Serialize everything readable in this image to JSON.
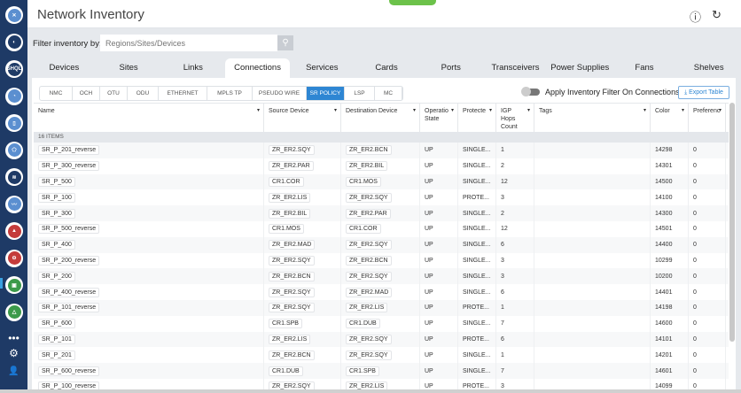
{
  "header": {
    "title": "Network Inventory",
    "help_icon": "help-icon",
    "refresh_icon": "refresh-icon"
  },
  "filter": {
    "label": "Filter inventory by:",
    "placeholder": "Regions/Sites/Devices"
  },
  "tabs": [
    "Devices",
    "Sites",
    "Links",
    "Connections",
    "Services",
    "Cards",
    "Ports",
    "Transceivers",
    "Power Supplies",
    "Fans",
    "Shelves"
  ],
  "active_tab": "Connections",
  "subtabs": [
    "NMC",
    "OCH",
    "OTU",
    "ODU",
    "ETHERNET",
    "MPLS TP",
    "PSEUDO WIRE",
    "SR POLICY",
    "LSP",
    "MC"
  ],
  "active_subtab": "SR POLICY",
  "toggle_label": "Apply Inventory Filter On Connections",
  "export_label": "Export Table",
  "columns": [
    "Name",
    "Source Device",
    "Destination Device",
    "Operatio State",
    "Protecte",
    "IGP Hops Count",
    "Tags",
    "Color",
    "Preferenc"
  ],
  "items_count": "16 ITEMS",
  "rows": [
    [
      "SR_P_201_reverse",
      "ZR_ER2.SQY",
      "ZR_ER2.BCN",
      "UP",
      "SINGLE...",
      "1",
      "",
      "14298",
      "0"
    ],
    [
      "SR_P_300_reverse",
      "ZR_ER2.PAR",
      "ZR_ER2.BIL",
      "UP",
      "SINGLE...",
      "2",
      "",
      "14301",
      "0"
    ],
    [
      "SR_P_500",
      "CR1.COR",
      "CR1.MOS",
      "UP",
      "SINGLE...",
      "12",
      "",
      "14500",
      "0"
    ],
    [
      "SR_P_100",
      "ZR_ER2.LIS",
      "ZR_ER2.SQY",
      "UP",
      "PROTE...",
      "3",
      "",
      "14100",
      "0"
    ],
    [
      "SR_P_300",
      "ZR_ER2.BIL",
      "ZR_ER2.PAR",
      "UP",
      "SINGLE...",
      "2",
      "",
      "14300",
      "0"
    ],
    [
      "SR_P_500_reverse",
      "CR1.MOS",
      "CR1.COR",
      "UP",
      "SINGLE...",
      "12",
      "",
      "14501",
      "0"
    ],
    [
      "SR_P_400",
      "ZR_ER2.MAD",
      "ZR_ER2.SQY",
      "UP",
      "SINGLE...",
      "6",
      "",
      "14400",
      "0"
    ],
    [
      "SR_P_200_reverse",
      "ZR_ER2.SQY",
      "ZR_ER2.BCN",
      "UP",
      "SINGLE...",
      "3",
      "",
      "10299",
      "0"
    ],
    [
      "SR_P_200",
      "ZR_ER2.BCN",
      "ZR_ER2.SQY",
      "UP",
      "SINGLE...",
      "3",
      "",
      "10200",
      "0"
    ],
    [
      "SR_P_400_reverse",
      "ZR_ER2.SQY",
      "ZR_ER2.MAD",
      "UP",
      "SINGLE...",
      "6",
      "",
      "14401",
      "0"
    ],
    [
      "SR_P_101_reverse",
      "ZR_ER2.SQY",
      "ZR_ER2.LIS",
      "UP",
      "PROTE...",
      "1",
      "",
      "14198",
      "0"
    ],
    [
      "SR_P_600",
      "CR1.SPB",
      "CR1.DUB",
      "UP",
      "SINGLE...",
      "7",
      "",
      "14600",
      "0"
    ],
    [
      "SR_P_101",
      "ZR_ER2.LIS",
      "ZR_ER2.SQY",
      "UP",
      "PROTE...",
      "6",
      "",
      "14101",
      "0"
    ],
    [
      "SR_P_201",
      "ZR_ER2.BCN",
      "ZR_ER2.SQY",
      "UP",
      "SINGLE...",
      "1",
      "",
      "14201",
      "0"
    ],
    [
      "SR_P_600_reverse",
      "CR1.DUB",
      "CR1.SPB",
      "UP",
      "SINGLE...",
      "7",
      "",
      "14601",
      "0"
    ],
    [
      "SR_P_100_reverse",
      "ZR_ER2.SQY",
      "ZR_ER2.LIS",
      "UP",
      "PROTE...",
      "3",
      "",
      "14099",
      "0"
    ]
  ],
  "sidebar": {
    "apps": [
      "network-icon",
      "pie-icon",
      "shql-icon",
      "globe-icon",
      "device-icon",
      "map-icon",
      "layers-icon",
      "trend-icon",
      "road-icon",
      "inspect-icon",
      "book-icon",
      "triangle-icon"
    ],
    "more": "•••",
    "settings": "⚙",
    "user": "👤",
    "shql_text": "SHQL"
  },
  "colors": {
    "sidebar": "#1e3a66",
    "accent": "#2e86d3",
    "green": "#6cc24a"
  }
}
